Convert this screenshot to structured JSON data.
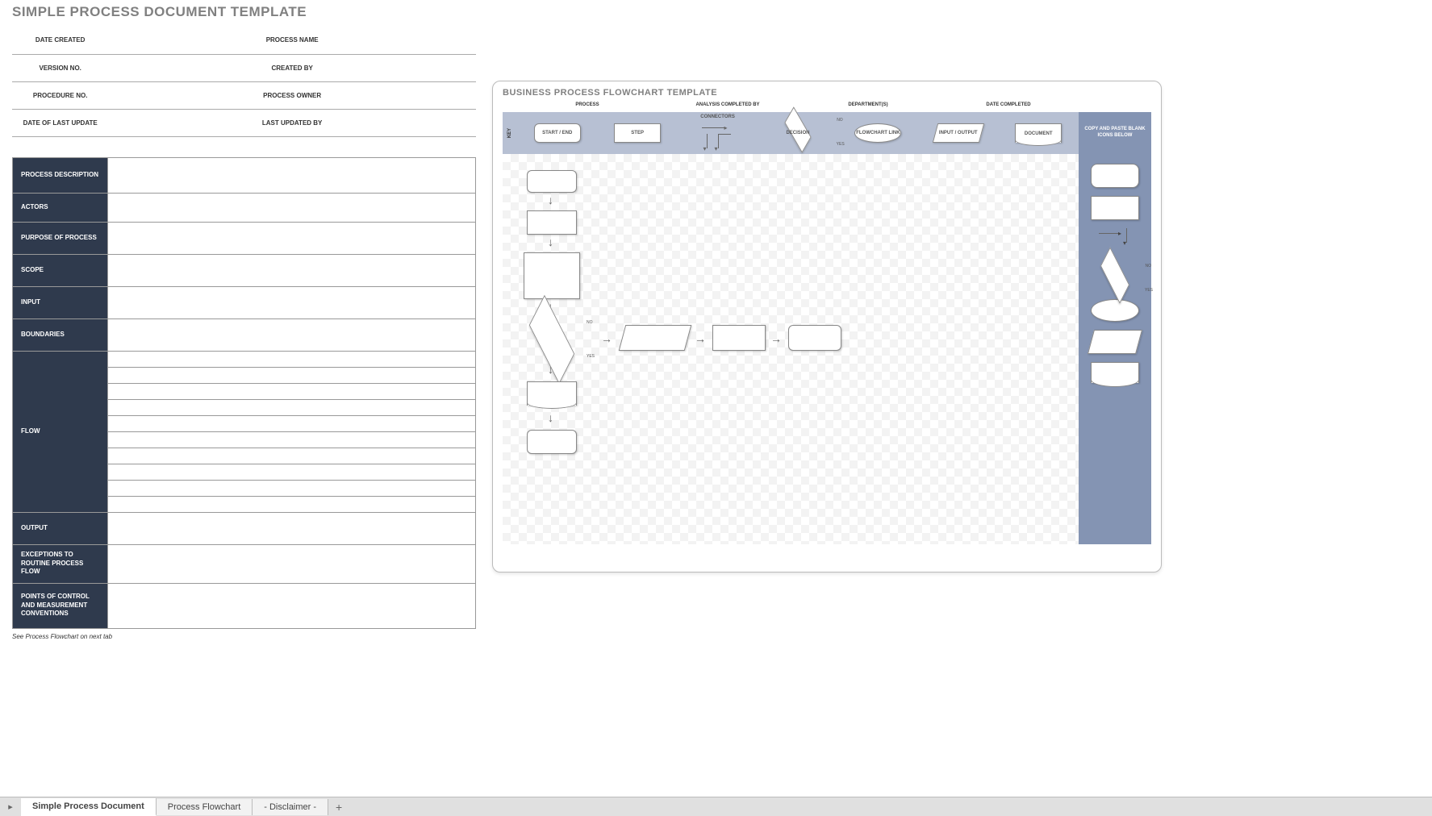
{
  "left": {
    "title": "SIMPLE PROCESS DOCUMENT TEMPLATE",
    "headers": {
      "date_created": "DATE CREATED",
      "process_name": "PROCESS NAME",
      "version_no": "VERSION NO.",
      "created_by": "CREATED BY",
      "procedure_no": "PROCEDURE NO.",
      "process_owner": "PROCESS OWNER",
      "date_last_update": "DATE OF LAST UPDATE",
      "last_updated_by": "LAST UPDATED BY"
    },
    "rows": {
      "process_description": "PROCESS DESCRIPTION",
      "actors": "ACTORS",
      "purpose": "PURPOSE OF PROCESS",
      "scope": "SCOPE",
      "input": "INPUT",
      "boundaries": "BOUNDARIES",
      "flow": "FLOW",
      "output": "OUTPUT",
      "exceptions": "EXCEPTIONS TO ROUTINE PROCESS FLOW",
      "points": "POINTS OF CONTROL AND MEASUREMENT CONVENTIONS"
    },
    "footnote": "See Process Flowchart on next tab"
  },
  "right": {
    "title": "BUSINESS PROCESS FLOWCHART TEMPLATE",
    "cols": {
      "process": "PROCESS",
      "analysis": "ANALYSIS COMPLETED BY",
      "dept": "DEPARTMENT(S)",
      "date": "DATE COMPLETED"
    },
    "key": {
      "label": "KEY",
      "start_end": "START / END",
      "step": "STEP",
      "connectors": "CONNECTORS",
      "decision": "DECISION",
      "no": "NO",
      "yes": "YES",
      "link": "FLOWCHART LINK",
      "io": "INPUT / OUTPUT",
      "document": "DOCUMENT",
      "copy_paste": "COPY AND PASTE BLANK ICONS BELOW"
    }
  },
  "tabs": {
    "t1": "Simple Process Document",
    "t2": "Process Flowchart",
    "t3": "- Disclaimer -"
  }
}
